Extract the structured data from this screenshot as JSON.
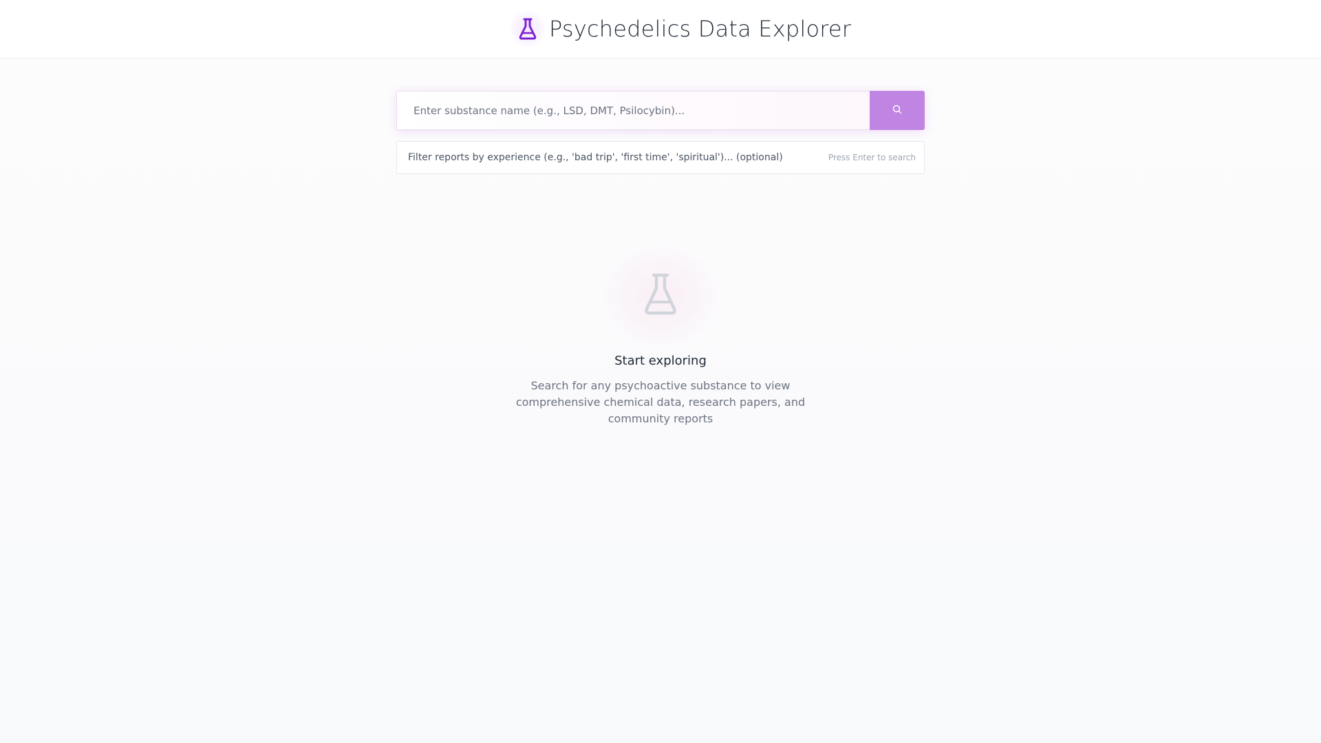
{
  "header": {
    "title": "Psychedelics Data Explorer",
    "logo_icon": "flask-icon"
  },
  "search": {
    "placeholder": "Enter substance name (e.g., LSD, DMT, Psilocybin)...",
    "value": "",
    "button_icon": "search-icon"
  },
  "filter": {
    "placeholder": "Filter reports by experience (e.g., 'bad trip', 'first time', 'spiritual')... (optional)",
    "value": "",
    "hint": "Press Enter to search"
  },
  "empty_state": {
    "icon": "flask-icon",
    "title": "Start exploring",
    "description": "Search for any psychoactive substance to view comprehensive chemical data, research papers, and community reports"
  },
  "colors": {
    "accent": "#7e22ce",
    "search_button": "#c084e3",
    "empty_icon": "#d1d5db"
  }
}
